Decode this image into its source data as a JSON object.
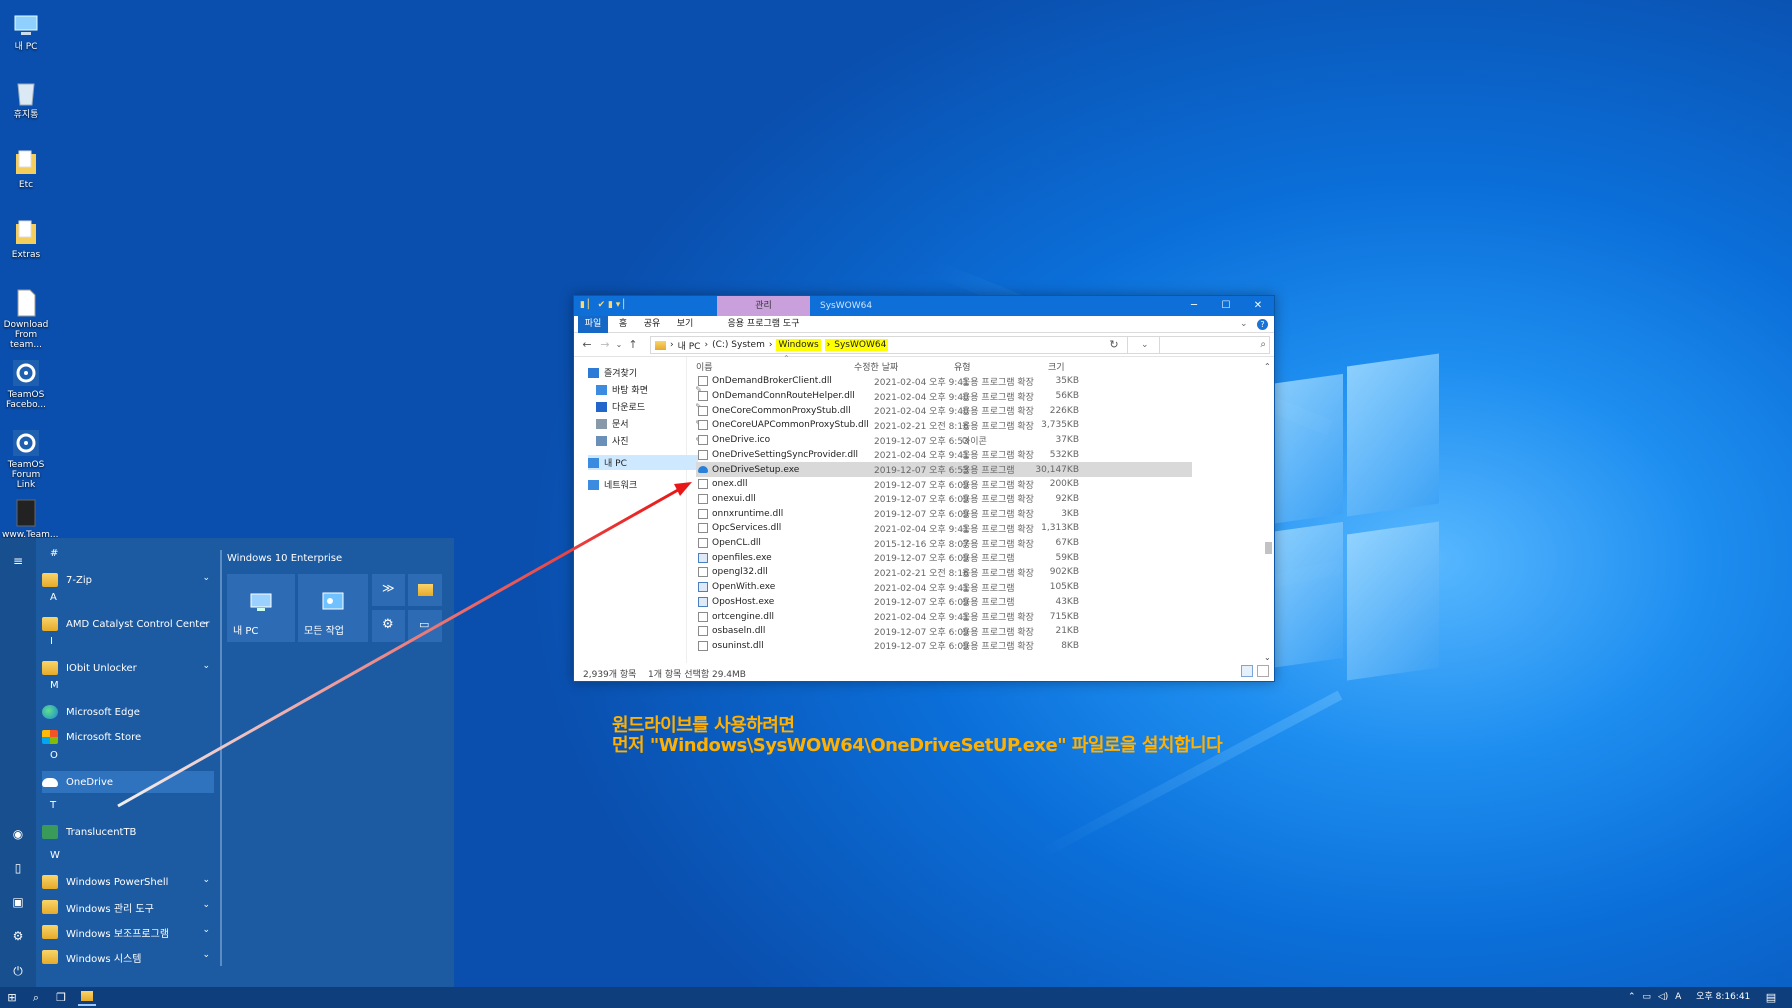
{
  "desktop": {
    "icons": [
      {
        "label": "내 PC",
        "icon": "computer-icon"
      },
      {
        "label": "휴지통",
        "icon": "recycle-bin-icon"
      },
      {
        "label": "Etc",
        "icon": "folder-icon"
      },
      {
        "label": "Extras",
        "icon": "folder-icon"
      },
      {
        "label": "Download From team...",
        "icon": "document-icon"
      },
      {
        "label": "TeamOS Facebo...",
        "icon": "gear-icon"
      },
      {
        "label": "TeamOS Forum Link",
        "icon": "gear-icon"
      },
      {
        "label": "www.Team...",
        "icon": "shortcut-icon"
      }
    ]
  },
  "start_menu": {
    "letters": [
      "#",
      "A",
      "I",
      "M",
      "O",
      "T",
      "W"
    ],
    "apps": [
      {
        "label": "7-Zip",
        "icon": "folder-icon",
        "expandable": true
      },
      {
        "label": "AMD Catalyst Control Center",
        "icon": "folder-icon",
        "expandable": true
      },
      {
        "label": "IObit Unlocker",
        "icon": "folder-icon",
        "expandable": true
      },
      {
        "label": "Microsoft Edge",
        "icon": "edge-icon",
        "expandable": false
      },
      {
        "label": "Microsoft Store",
        "icon": "store-icon",
        "expandable": false
      },
      {
        "label": "OneDrive",
        "icon": "onedrive-icon",
        "expandable": false
      },
      {
        "label": "TranslucentTB",
        "icon": "translucenttb-icon",
        "expandable": false
      },
      {
        "label": "Windows PowerShell",
        "icon": "folder-icon",
        "expandable": true
      },
      {
        "label": "Windows 관리 도구",
        "icon": "folder-icon",
        "expandable": true
      },
      {
        "label": "Windows 보조프로그램",
        "icon": "folder-icon",
        "expandable": true
      },
      {
        "label": "Windows 시스템",
        "icon": "folder-icon",
        "expandable": true
      }
    ],
    "tiles_title": "Windows 10 Enterprise",
    "tiles": [
      {
        "label": "내 PC",
        "icon": "computer-icon"
      },
      {
        "label": "모든 작업",
        "icon": "control-panel-icon"
      }
    ]
  },
  "explorer": {
    "title": "SysWOW64",
    "context_tab": "관리",
    "ribbon_tabs": [
      "파일",
      "홈",
      "공유",
      "보기",
      "응용 프로그램 도구"
    ],
    "address": {
      "root": "내 PC",
      "segments": [
        "(C:) System",
        "Windows",
        "SysWOW64"
      ]
    },
    "nav_pane": [
      {
        "label": "즐겨찾기",
        "icon": "star-icon",
        "pinned": false
      },
      {
        "label": "바탕 화면",
        "icon": "desktop-icon",
        "pinned": true
      },
      {
        "label": "다운로드",
        "icon": "download-icon",
        "pinned": true
      },
      {
        "label": "문서",
        "icon": "documents-icon",
        "pinned": true
      },
      {
        "label": "사진",
        "icon": "pictures-icon",
        "pinned": true
      },
      {
        "label": "내 PC",
        "icon": "computer-icon",
        "pinned": false
      },
      {
        "label": "네트워크",
        "icon": "network-icon",
        "pinned": false
      }
    ],
    "columns": [
      "이름",
      "수정한 날짜",
      "유형",
      "크기"
    ],
    "files": [
      {
        "name": "OnDemandBrokerClient.dll",
        "date": "2021-02-04 오후 9:41",
        "type": "응용 프로그램 확장",
        "size": "35KB"
      },
      {
        "name": "OnDemandConnRouteHelper.dll",
        "date": "2021-02-04 오후 9:40",
        "type": "응용 프로그램 확장",
        "size": "56KB"
      },
      {
        "name": "OneCoreCommonProxyStub.dll",
        "date": "2021-02-04 오후 9:40",
        "type": "응용 프로그램 확장",
        "size": "226KB"
      },
      {
        "name": "OneCoreUAPCommonProxyStub.dll",
        "date": "2021-02-21 오전 8:16",
        "type": "응용 프로그램 확장",
        "size": "3,735KB"
      },
      {
        "name": "OneDrive.ico",
        "date": "2019-12-07 오후 6:53",
        "type": "아이콘",
        "size": "37KB"
      },
      {
        "name": "OneDriveSettingSyncProvider.dll",
        "date": "2021-02-04 오후 9:41",
        "type": "응용 프로그램 확장",
        "size": "532KB"
      },
      {
        "name": "OneDriveSetup.exe",
        "date": "2019-12-07 오후 6:53",
        "type": "응용 프로그램",
        "size": "30,147KB",
        "selected": true
      },
      {
        "name": "onex.dll",
        "date": "2019-12-07 오후 6:09",
        "type": "응용 프로그램 확장",
        "size": "200KB"
      },
      {
        "name": "onexui.dll",
        "date": "2019-12-07 오후 6:09",
        "type": "응용 프로그램 확장",
        "size": "92KB"
      },
      {
        "name": "onnxruntime.dll",
        "date": "2019-12-07 오후 6:09",
        "type": "응용 프로그램 확장",
        "size": "3KB"
      },
      {
        "name": "OpcServices.dll",
        "date": "2021-02-04 오후 9:41",
        "type": "응용 프로그램 확장",
        "size": "1,313KB"
      },
      {
        "name": "OpenCL.dll",
        "date": "2015-12-16 오후 8:07",
        "type": "응용 프로그램 확장",
        "size": "67KB"
      },
      {
        "name": "openfiles.exe",
        "date": "2019-12-07 오후 6:09",
        "type": "응용 프로그램",
        "size": "59KB"
      },
      {
        "name": "opengl32.dll",
        "date": "2021-02-21 오전 8:16",
        "type": "응용 프로그램 확장",
        "size": "902KB"
      },
      {
        "name": "OpenWith.exe",
        "date": "2021-02-04 오후 9:41",
        "type": "응용 프로그램",
        "size": "105KB"
      },
      {
        "name": "OposHost.exe",
        "date": "2019-12-07 오후 6:09",
        "type": "응용 프로그램",
        "size": "43KB"
      },
      {
        "name": "ortcengine.dll",
        "date": "2021-02-04 오후 9:41",
        "type": "응용 프로그램 확장",
        "size": "715KB"
      },
      {
        "name": "osbaseln.dll",
        "date": "2019-12-07 오후 6:09",
        "type": "응용 프로그램 확장",
        "size": "21KB"
      },
      {
        "name": "osuninst.dll",
        "date": "2019-12-07 오후 6:09",
        "type": "응용 프로그램 확장",
        "size": "8KB"
      }
    ],
    "status": {
      "count": "2,939개 항목",
      "selection": "1개 항목 선택함 29.4MB"
    }
  },
  "annotation": {
    "line1": "원드라이브를 사용하려면",
    "line2": "먼저 \"Windows\\SysWOW64\\OneDriveSetUP.exe\" 파일로을 설치합니다",
    "color": "#ffb000"
  },
  "taskbar": {
    "time": "오후 8:16:41",
    "ime": "A"
  },
  "colors": {
    "accent": "#0d6fd7",
    "start_bg": "#1c5ba2",
    "taskbar": "#0e3e7c",
    "context_tab": "#c9a0dc",
    "highlight": "#ffff00"
  }
}
